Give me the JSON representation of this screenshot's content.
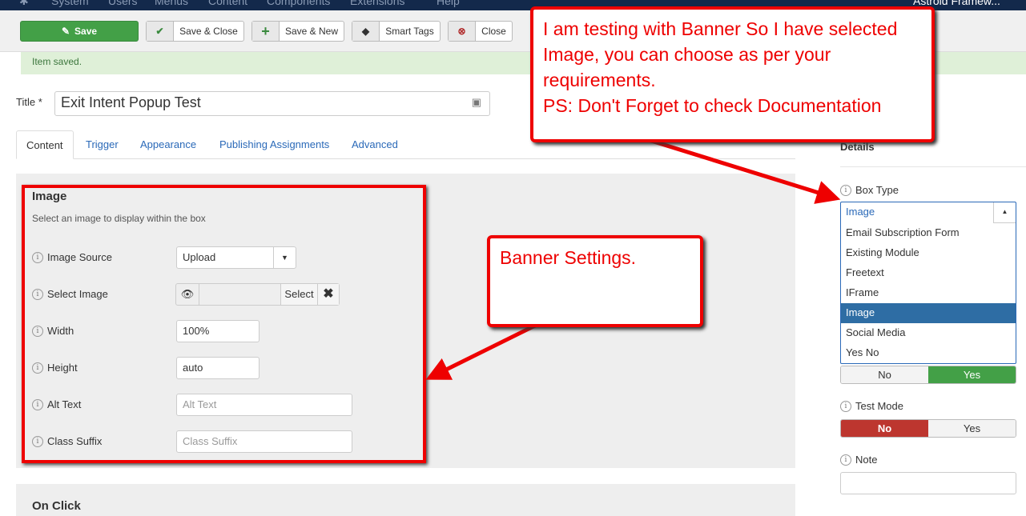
{
  "topnav": {
    "items": [
      "System",
      "Users",
      "Menus",
      "Content",
      "Components",
      "Extensions",
      "Help"
    ],
    "user": "Astroid Framew..."
  },
  "toolbar": {
    "save": "Save",
    "save_close": "Save & Close",
    "save_new": "Save & New",
    "smart_tags": "Smart Tags",
    "close": "Close"
  },
  "message": "Item saved.",
  "title": {
    "label": "Title *",
    "value": "Exit Intent Popup Test"
  },
  "tabs": [
    "Content",
    "Trigger",
    "Appearance",
    "Publishing Assignments",
    "Advanced"
  ],
  "image_section": {
    "heading": "Image",
    "description": "Select an image to display within the box",
    "image_source": {
      "label": "Image Source",
      "value": "Upload"
    },
    "select_image": {
      "label": "Select Image",
      "button": "Select"
    },
    "width": {
      "label": "Width",
      "value": "100%"
    },
    "height": {
      "label": "Height",
      "value": "auto"
    },
    "alt_text": {
      "label": "Alt Text",
      "placeholder": "Alt Text"
    },
    "class_suffix": {
      "label": "Class Suffix",
      "placeholder": "Class Suffix"
    }
  },
  "on_click": {
    "heading": "On Click"
  },
  "sidebar": {
    "details": "Details",
    "box_type": {
      "label": "Box Type",
      "value": "Image",
      "options": [
        "Email Subscription Form",
        "Existing Module",
        "Freetext",
        "IFrame",
        "Image",
        "Social Media",
        "Yes No"
      ],
      "selected": "Image"
    },
    "toggle1": {
      "no": "No",
      "yes": "Yes",
      "active": "Yes"
    },
    "test_mode": {
      "label": "Test Mode",
      "no": "No",
      "yes": "Yes",
      "active": "No"
    },
    "note": {
      "label": "Note",
      "value": ""
    }
  },
  "annotations": {
    "callout1": "I am testing with Banner So I have selected Image, you can choose as per your requirements.",
    "callout1_ps": "PS: Don't Forget to check Documentation",
    "callout2": "Banner Settings."
  },
  "colors": {
    "green": "#43a047",
    "red": "#bd362f",
    "blue": "#2e6da4",
    "annotation": "#ee0000"
  }
}
